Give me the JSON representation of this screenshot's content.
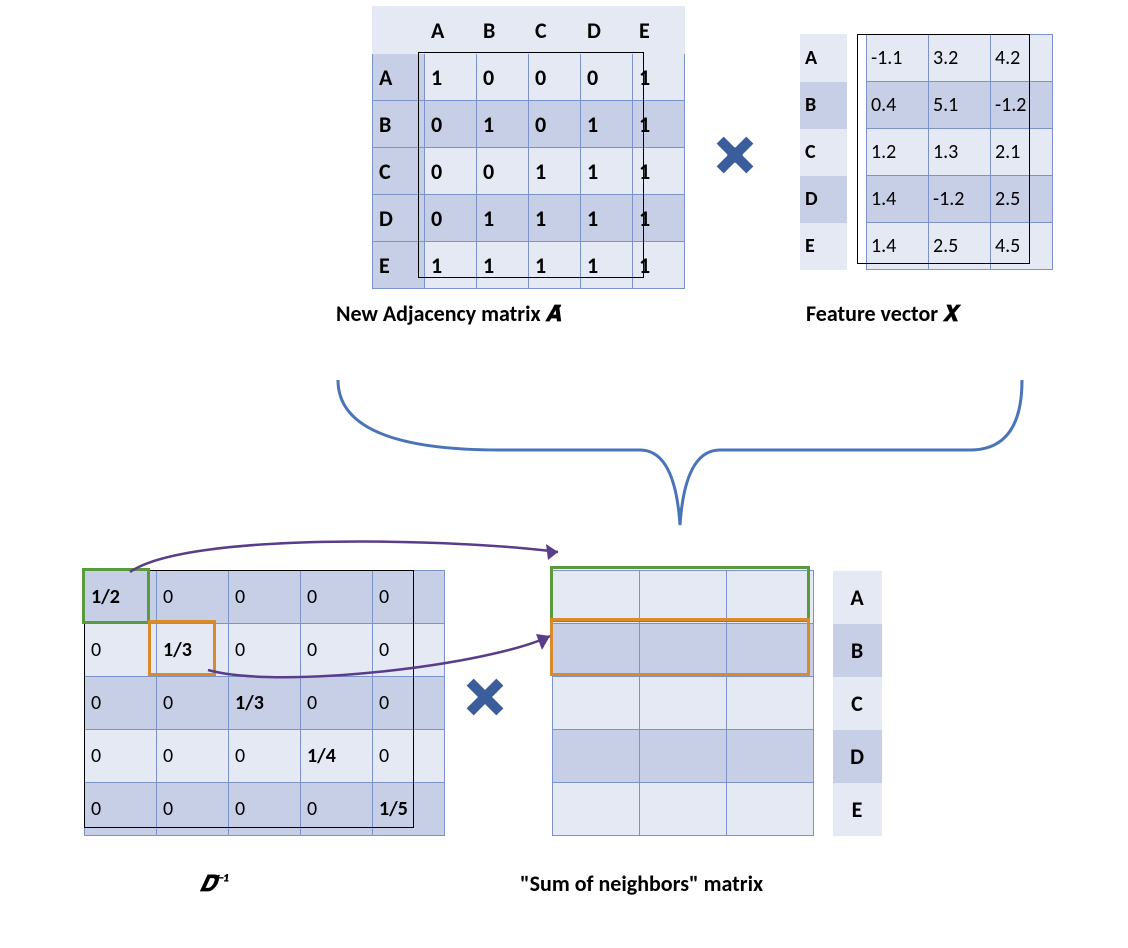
{
  "labels": {
    "nodes": [
      "A",
      "B",
      "C",
      "D",
      "E"
    ]
  },
  "adjacency": {
    "caption": "New Adjacency matrix 𝑨̃",
    "rows": [
      [
        1,
        0,
        0,
        0,
        1
      ],
      [
        0,
        1,
        0,
        1,
        1
      ],
      [
        0,
        0,
        1,
        1,
        1
      ],
      [
        0,
        1,
        1,
        1,
        1
      ],
      [
        1,
        1,
        1,
        1,
        1
      ]
    ]
  },
  "featureX": {
    "caption": "Feature vector 𝑿",
    "rows": [
      [
        -1.1,
        3.2,
        4.2
      ],
      [
        0.4,
        5.1,
        -1.2
      ],
      [
        1.2,
        1.3,
        2.1
      ],
      [
        1.4,
        -1.2,
        2.5
      ],
      [
        1.4,
        2.5,
        4.5
      ]
    ]
  },
  "dinv": {
    "caption": "𝑫̃⁻¹",
    "diag": [
      "1/2",
      "1/3",
      "1/3",
      "1/4",
      "1/5"
    ]
  },
  "sumN": {
    "caption": "\"Sum of neighbors\" matrix"
  },
  "highlights": {
    "green": "#5a9a3f",
    "orange": "#d88b2a"
  }
}
